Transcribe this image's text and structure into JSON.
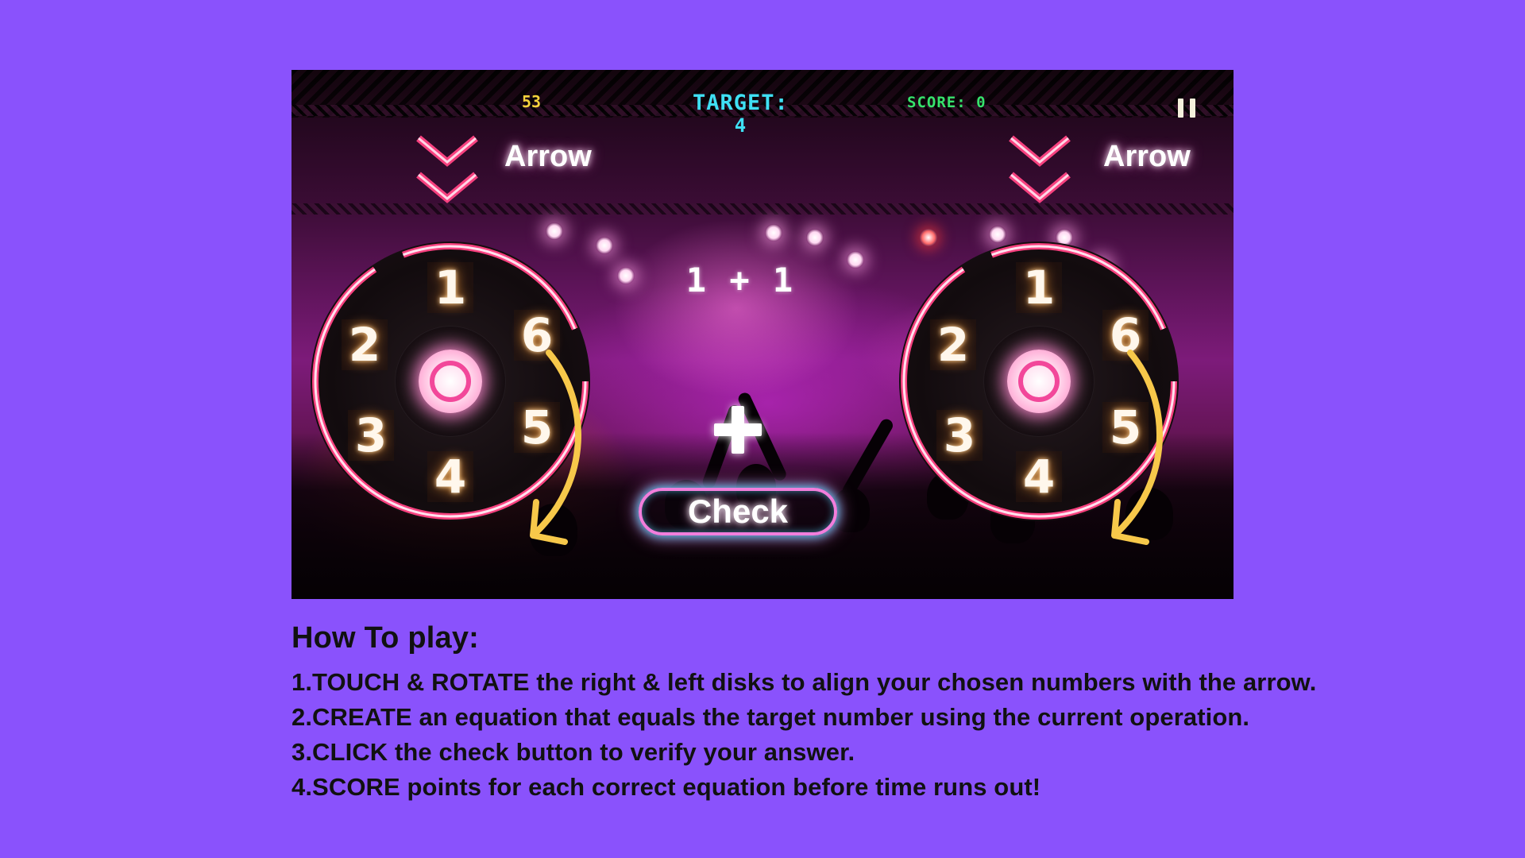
{
  "hud": {
    "timer": "53",
    "target_label": "TARGET:",
    "target_value": "4",
    "score": "SCORE: 0"
  },
  "arrows": {
    "left_label": "Arrow",
    "right_label": "Arrow"
  },
  "disks": {
    "left": [
      "1",
      "6",
      "5",
      "4",
      "3",
      "2"
    ],
    "right": [
      "1",
      "6",
      "5",
      "4",
      "3",
      "2"
    ]
  },
  "equation": "1 + 1",
  "operation": "+",
  "check_label": "Check",
  "howto": {
    "title": "How To play:",
    "steps": [
      "1.TOUCH & ROTATE the right & left disks to align your chosen numbers with the arrow.",
      "2.CREATE an equation that equals the target number using the current operation.",
      "3.CLICK the check button to verify your answer.",
      "4.SCORE points for each correct equation before time runs out!"
    ]
  },
  "colors": {
    "page_background": "#8a52fc",
    "neon_pink": "#f7417f",
    "rotate_arrow": "#f7c84a",
    "target_text": "#3fe0f4",
    "score_text": "#36e36c",
    "timer_text": "#f4d23c"
  },
  "icons": {
    "pause": "pause-icon",
    "arrow_indicator": "double-chevron-down-icon",
    "rotate": "curved-arrow-icon",
    "operator": "plus-icon"
  }
}
